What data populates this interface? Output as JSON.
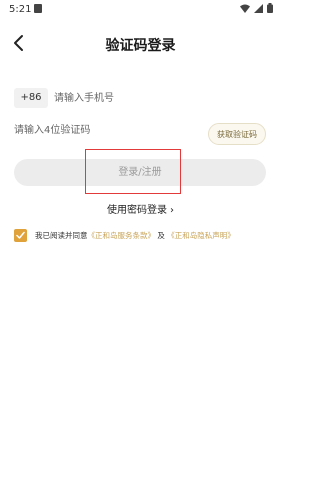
{
  "status_bar": {
    "time": "5:21"
  },
  "header": {
    "title": "验证码登录"
  },
  "phone": {
    "country_code": "+86",
    "placeholder": "请输入手机号"
  },
  "code": {
    "placeholder": "请输入4位验证码",
    "get_code_label": "获取验证码"
  },
  "login_button_label": "登录/注册",
  "password_login_label": "使用密码登录",
  "agreement": {
    "checked": true,
    "prefix": "我已阅读并同意",
    "terms_link": "《正和岛服务条款》",
    "and": "及",
    "privacy_link": "《正和岛隐私声明》"
  },
  "colors": {
    "accent": "#e0a23a",
    "link": "#c9a45a",
    "highlight": "#e23a3a"
  }
}
